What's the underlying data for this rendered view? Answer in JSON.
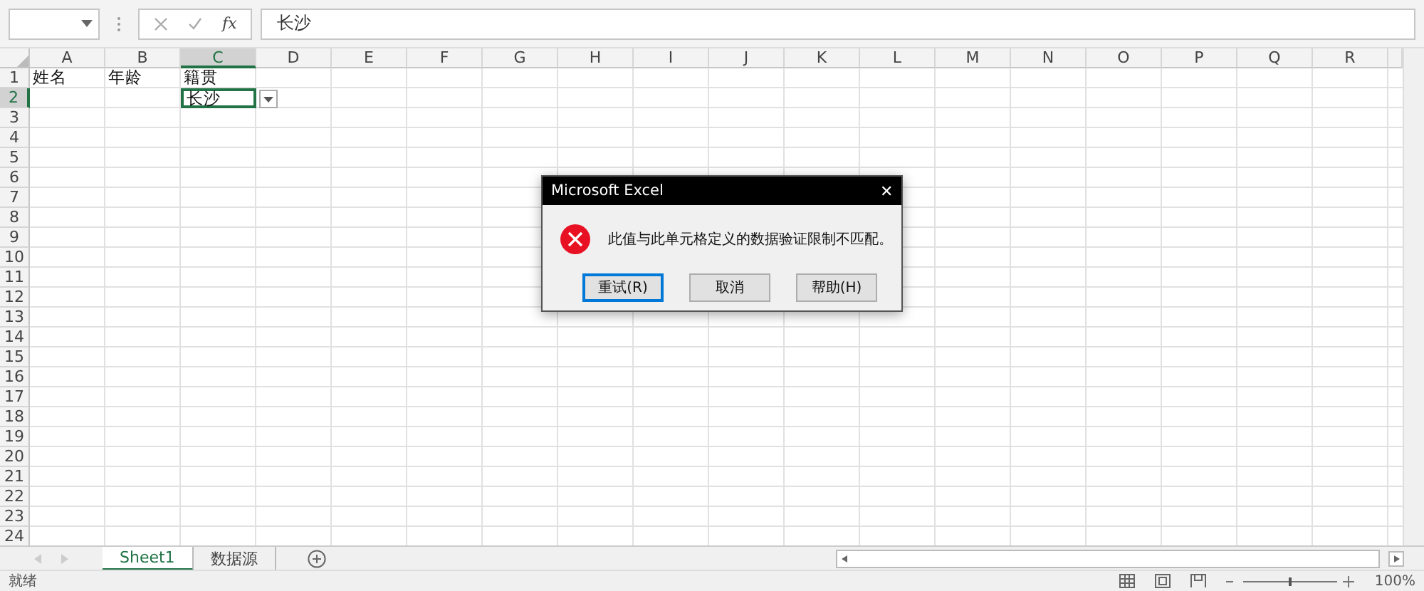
{
  "formula_bar": {
    "fx": "fx",
    "value": "长沙"
  },
  "columns": [
    {
      "label": "A",
      "selected": false
    },
    {
      "label": "B",
      "selected": false
    },
    {
      "label": "C",
      "selected": true
    },
    {
      "label": "D",
      "selected": false
    },
    {
      "label": "E",
      "selected": false
    },
    {
      "label": "F",
      "selected": false
    },
    {
      "label": "G",
      "selected": false
    },
    {
      "label": "H",
      "selected": false
    },
    {
      "label": "I",
      "selected": false
    },
    {
      "label": "J",
      "selected": false
    },
    {
      "label": "K",
      "selected": false
    },
    {
      "label": "L",
      "selected": false
    },
    {
      "label": "M",
      "selected": false
    },
    {
      "label": "N",
      "selected": false
    },
    {
      "label": "O",
      "selected": false
    },
    {
      "label": "P",
      "selected": false
    },
    {
      "label": "Q",
      "selected": false
    },
    {
      "label": "R",
      "selected": false
    }
  ],
  "rows": [
    {
      "label": "1",
      "selected": false,
      "cells": [
        {
          "kind": "text",
          "text": "姓名",
          "selected": false
        },
        {
          "kind": "text",
          "text": "年龄",
          "selected": false
        },
        {
          "kind": "text",
          "text": "籍贯",
          "selected": false
        }
      ]
    },
    {
      "label": "2",
      "selected": true,
      "cells": [
        {
          "kind": "empty"
        },
        {
          "kind": "empty"
        },
        {
          "kind": "text",
          "text": "长沙",
          "selected": true,
          "dropdown": true
        }
      ]
    },
    {
      "label": "3",
      "selected": false
    },
    {
      "label": "4",
      "selected": false
    },
    {
      "label": "5",
      "selected": false
    },
    {
      "label": "6",
      "selected": false
    },
    {
      "label": "7",
      "selected": false
    },
    {
      "label": "8",
      "selected": false
    },
    {
      "label": "9",
      "selected": false
    },
    {
      "label": "10",
      "selected": false
    },
    {
      "label": "11",
      "selected": false
    },
    {
      "label": "12",
      "selected": false
    },
    {
      "label": "13",
      "selected": false
    },
    {
      "label": "14",
      "selected": false
    },
    {
      "label": "15",
      "selected": false
    },
    {
      "label": "16",
      "selected": false
    },
    {
      "label": "17",
      "selected": false
    },
    {
      "label": "18",
      "selected": false
    },
    {
      "label": "19",
      "selected": false
    },
    {
      "label": "20",
      "selected": false
    },
    {
      "label": "21",
      "selected": false
    },
    {
      "label": "22",
      "selected": false
    },
    {
      "label": "23",
      "selected": false
    },
    {
      "label": "24",
      "selected": false
    }
  ],
  "sheet_tabs": [
    {
      "label": "Sheet1",
      "selected": true
    },
    {
      "label": "数据源",
      "selected": false
    }
  ],
  "dialog": {
    "title": "Microsoft Excel",
    "close": "✕",
    "message": "此值与此单元格定义的数据验证限制不匹配。",
    "buttons": [
      {
        "label": "重试(R)",
        "selected": true
      },
      {
        "label": "取消",
        "selected": false
      },
      {
        "label": "帮助(H)",
        "selected": false
      }
    ]
  },
  "status_bar": {
    "status": "就绪",
    "zoom_slider": {
      "level": 0.5
    },
    "zoom": "100%"
  }
}
